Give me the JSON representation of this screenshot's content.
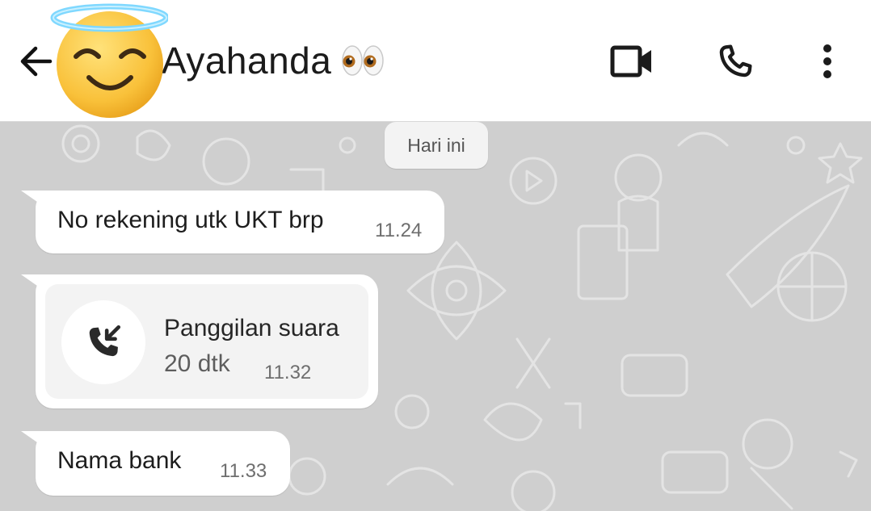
{
  "header": {
    "contact_name": "Ayahanda",
    "name_emoji": "eyes-emoji",
    "avatar_emoji": "smiling-face-with-halo",
    "icons": {
      "back": "arrow-left-icon",
      "video": "video-call-icon",
      "call": "phone-icon",
      "menu": "more-vertical-icon"
    }
  },
  "chat": {
    "date_separator": "Hari ini",
    "messages": [
      {
        "type": "text",
        "text": "No rekening utk UKT brp",
        "time": "11.24"
      },
      {
        "type": "call",
        "title": "Panggilan suara",
        "duration": "20 dtk",
        "time": "11.32",
        "icon": "missed-incoming-call-icon"
      },
      {
        "type": "text",
        "text": "Nama bank",
        "time": "11.33"
      }
    ]
  },
  "colors": {
    "wallpaper": "#cfcfcf",
    "bubble": "#ffffff",
    "call_card": "#f3f3f3",
    "header_bg": "#ffffff"
  }
}
